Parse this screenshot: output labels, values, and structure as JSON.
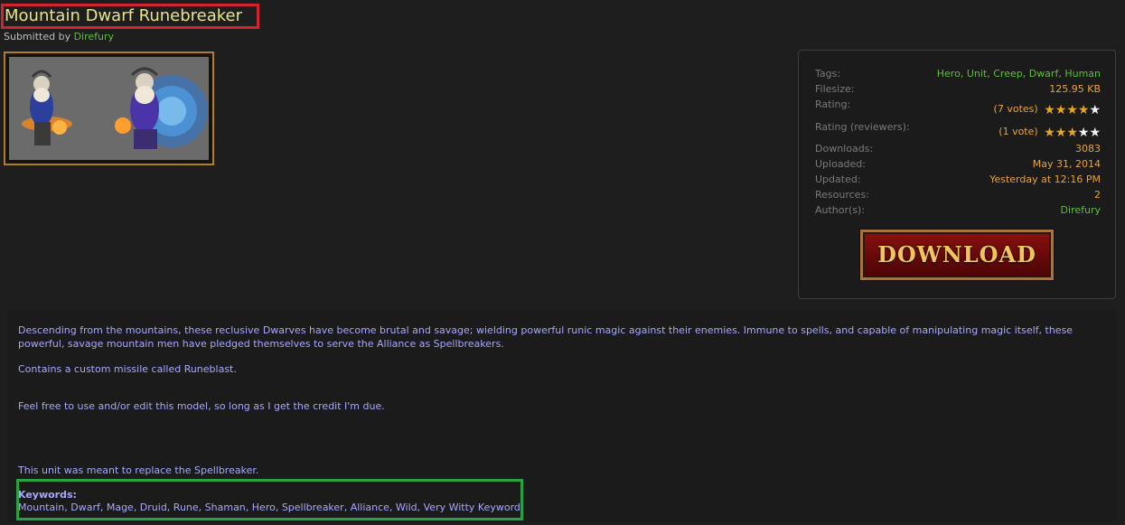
{
  "page": {
    "title": "Mountain Dwarf Runebreaker",
    "submitted_by_label": "Submitted by",
    "author": "Direfury"
  },
  "preview": {
    "alt": "Mountain Dwarf Runebreaker preview"
  },
  "info": {
    "tags_label": "Tags:",
    "tags": [
      "Hero",
      "Unit",
      "Creep",
      "Dwarf",
      "Human"
    ],
    "filesize_label": "Filesize:",
    "filesize": "125.95 KB",
    "rating_label": "Rating:",
    "rating_votes": "(7 votes)",
    "rating_stars": 4,
    "reviewer_label": "Rating (reviewers):",
    "reviewer_votes": "(1 vote)",
    "reviewer_stars": 3,
    "downloads_label": "Downloads:",
    "downloads": "3083",
    "uploaded_label": "Uploaded:",
    "uploaded": "May 31, 2014",
    "updated_label": "Updated:",
    "updated": "Yesterday at 12:16 PM",
    "resources_label": "Resources:",
    "resources": "2",
    "authors_label": "Author(s):",
    "authors": "Direfury",
    "download_label": "DOWNLOAD"
  },
  "description": {
    "p1": "Descending from the mountains, these reclusive Dwarves have become brutal and savage; wielding powerful runic magic against their enemies. Immune to spells, and capable of manipulating magic itself, these powerful, savage mountain men have pledged themselves to serve the Alliance as Spellbreakers.",
    "p2": "Contains a custom missile called Runeblast.",
    "p3": "Feel free to use and/or edit this model, so long as I get the credit I'm due.",
    "p4": "This unit was meant to replace the Spellbreaker.",
    "keywords_label": "Keywords:",
    "keywords": "Mountain, Dwarf, Mage, Druid, Rune, Shaman, Hero, Spellbreaker, Alliance, Wild, Very Witty Keyword"
  }
}
